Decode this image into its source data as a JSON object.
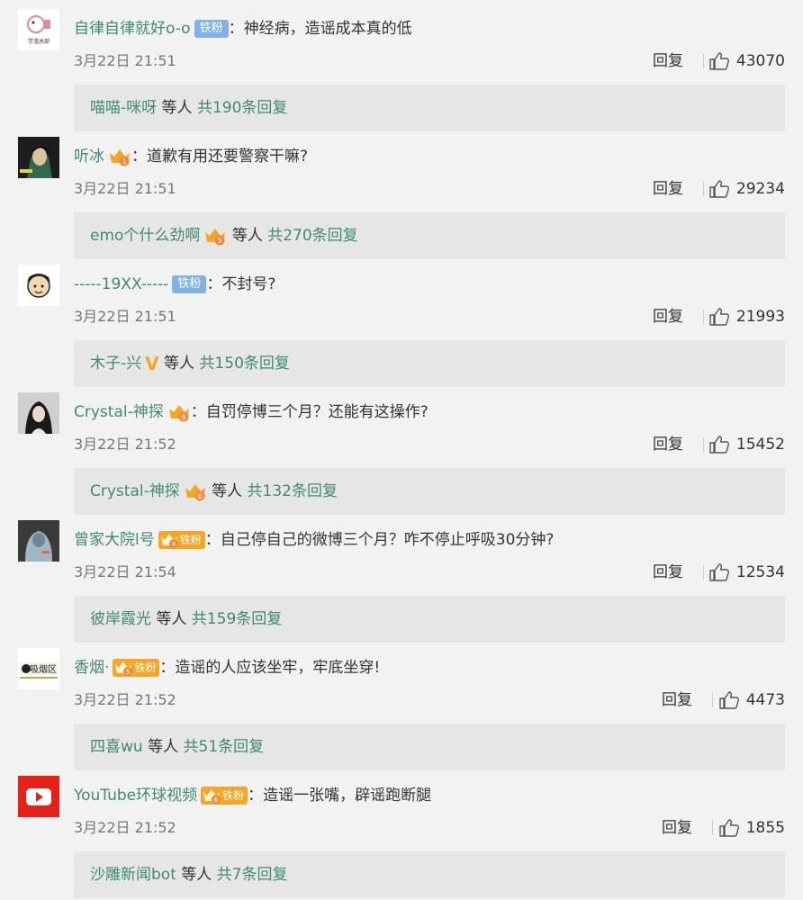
{
  "comments": [
    {
      "user": "自律自律就好o-o",
      "fan_badge": "铁粉",
      "text": "：神经病，造谣成本真的低",
      "time": "3月22日 21:51",
      "reply_label": "回复",
      "likes": "43070",
      "sub_name": "喵喵-咪呀",
      "sub_etc": " 等人 ",
      "sub_total": "共190条回复",
      "avatar_text": "学渣总部"
    },
    {
      "user": "听冰",
      "vip_level": "1",
      "text": "：道歉有用还要警察干嘛?",
      "time": "3月22日 21:51",
      "reply_label": "回复",
      "likes": "29234",
      "sub_name": "emo个什么劲啊",
      "sub_vip_level": "5",
      "sub_etc": " 等人 ",
      "sub_total": "共270条回复"
    },
    {
      "user": "-----19XX-----",
      "fan_badge": "铁粉",
      "text": "：不封号?",
      "time": "3月22日 21:51",
      "reply_label": "回复",
      "likes": "21993",
      "sub_name": "木子-兴",
      "sub_v_badge": "V",
      "sub_etc": " 等人 ",
      "sub_total": "共150条回复"
    },
    {
      "user": "Crystal-神探",
      "vip_level": "6",
      "text": "：自罚停博三个月？还能有这操作?",
      "time": "3月22日 21:52",
      "reply_label": "回复",
      "likes": "15452",
      "sub_name": "Crystal-神探",
      "sub_vip_level": "6",
      "sub_etc": " 等人 ",
      "sub_total": "共132条回复"
    },
    {
      "user": "曾家大院l号",
      "vip_level": "4",
      "vip_fan": "铁粉",
      "text": "：自己停自己的微博三个月？咋不停止呼吸30分钟?",
      "time": "3月22日 21:54",
      "reply_label": "回复",
      "likes": "12534",
      "sub_name": "彼岸霞光",
      "sub_etc": " 等人 ",
      "sub_total": "共159条回复"
    },
    {
      "user": "香烟·",
      "vip_level": "5",
      "vip_fan": "铁粉",
      "text": "：造谣的人应该坐牢，牢底坐穿!",
      "time": "3月22日 21:52",
      "reply_label": "回复",
      "likes": "4473",
      "sub_name": "四喜wu",
      "sub_etc": " 等人 ",
      "sub_total": "共51条回复",
      "avatar_text": "吸烟区"
    },
    {
      "user": "YouTube环球视频",
      "vip_level": "6",
      "vip_fan": "铁粉",
      "text": "：造谣一张嘴，辟谣跑断腿",
      "time": "3月22日 21:52",
      "reply_label": "回复",
      "likes": "1855",
      "sub_name": "沙雕新闻bot",
      "sub_etc": " 等人 ",
      "sub_total": "共7条回复"
    }
  ],
  "colors": {
    "username": "#3f8a72",
    "fan_badge": "#7fb2e5",
    "vip_crown": "#f5a623",
    "background": "#f2f2f2",
    "subbox": "#e6e6e6"
  },
  "icons": [
    "thumbs-up-icon",
    "crown-vip-icon",
    "v-verified-icon",
    "youtube-icon"
  ]
}
